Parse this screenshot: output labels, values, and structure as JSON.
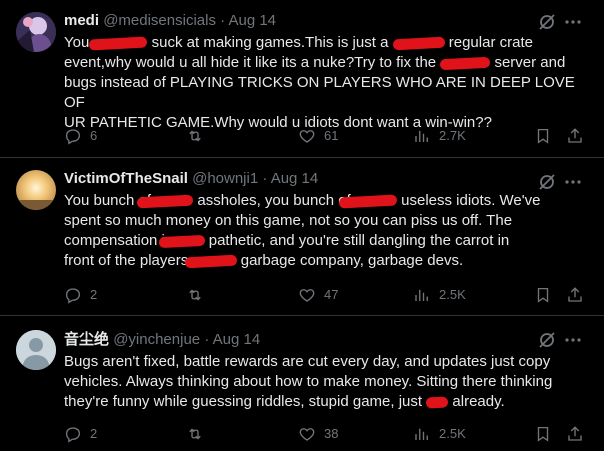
{
  "tweets": [
    {
      "display_name": "medi",
      "handle": "@medisensicials",
      "sep": "·",
      "date": "Aug 14",
      "text": {
        "l1a": "You ",
        "l1b": " suck at making games.This is just a ",
        "l1c": " regular crate",
        "l2": "event,why would u all hide it like its a nuke?Try to fix the ",
        "l2b": " server and",
        "l3": "bugs instead of PLAYING TRICKS ON PLAYERS WHO ARE IN DEEP LOVE OF",
        "l4": "UR PATHETIC GAME.Why would u idiots dont want a win-win??"
      },
      "replies": "6",
      "reposts": "",
      "likes": "61",
      "views": "2.7K"
    },
    {
      "display_name": "VictimOfTheSnail",
      "handle": "@hownji1",
      "sep": "·",
      "date": "Aug 14",
      "text": {
        "l1a": "You bunch of ",
        "l1b": " assholes, you bunch of ",
        "l1c": " useless idiots. We've",
        "l2": "spent so much money on this game, not so you can piss us off. The",
        "l3a": "compensation is ",
        "l3b": " pathetic, and you're still dangling the carrot in",
        "l4a": "front of the players. ",
        "l4b": " garbage company, garbage devs."
      },
      "replies": "2",
      "reposts": "",
      "likes": "47",
      "views": "2.5K"
    },
    {
      "display_name": "音尘绝",
      "handle": "@yinchenjue",
      "sep": "·",
      "date": "Aug 14",
      "text": {
        "l1": "Bugs aren't fixed, battle rewards are cut every day, and updates just copy",
        "l2": "vehicles. Always thinking about how to make money. Sitting there thinking",
        "l3a": "they're funny while guessing riddles, stupid game, just ",
        "l3b": " already."
      },
      "replies": "2",
      "reposts": "",
      "likes": "38",
      "views": "2.5K"
    }
  ],
  "colors": {
    "background": "#000000",
    "text": "#e7e9ea",
    "muted": "#71767b",
    "divider": "#2f3336",
    "redaction": "#e0121a"
  }
}
